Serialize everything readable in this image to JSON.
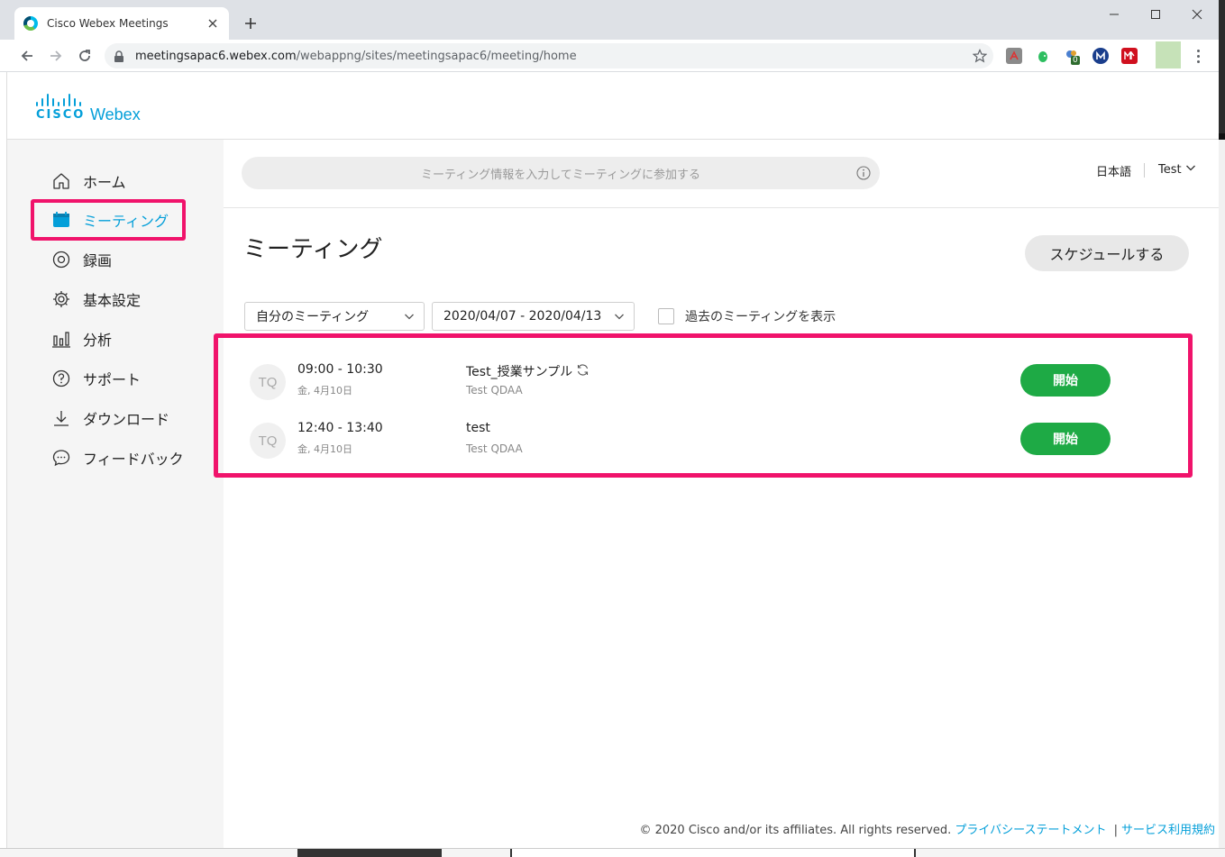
{
  "browser": {
    "tab_title": "Cisco Webex Meetings",
    "url_host": "meetingsapac6.webex.com",
    "url_path": "/webappng/sites/meetingsapac6/meeting/home",
    "extension_badge": "0"
  },
  "header": {
    "logo_cisco": "CISCO",
    "logo_webex": "Webex"
  },
  "search": {
    "placeholder": "ミーティング情報を入力してミーティングに参加する"
  },
  "topbar": {
    "language": "日本語",
    "user": "Test"
  },
  "sidebar": {
    "items": [
      {
        "label": "ホーム",
        "icon": "home-icon"
      },
      {
        "label": "ミーティング",
        "icon": "calendar-icon",
        "active": true
      },
      {
        "label": "録画",
        "icon": "recording-icon"
      },
      {
        "label": "基本設定",
        "icon": "gear-icon"
      },
      {
        "label": "分析",
        "icon": "analytics-icon"
      },
      {
        "label": "サポート",
        "icon": "help-icon"
      },
      {
        "label": "ダウンロード",
        "icon": "download-icon"
      },
      {
        "label": "フィードバック",
        "icon": "feedback-icon"
      }
    ]
  },
  "main": {
    "title": "ミーティング",
    "schedule_label": "スケジュールする",
    "filter_owner": "自分のミーティング",
    "filter_range": "2020/04/07 - 2020/04/13",
    "show_past_label": "過去のミーティングを表示",
    "show_past_checked": false
  },
  "meetings": [
    {
      "avatar": "TQ",
      "time": "09:00 - 10:30",
      "date": "金, 4月10日",
      "title": "Test_授業サンプル",
      "recurring": true,
      "host": "Test QDAA",
      "start_label": "開始"
    },
    {
      "avatar": "TQ",
      "time": "12:40 - 13:40",
      "date": "金, 4月10日",
      "title": "test",
      "recurring": false,
      "host": "Test QDAA",
      "start_label": "開始"
    }
  ],
  "footer": {
    "copyright": "© 2020 Cisco and/or its affiliates. All rights reserved.",
    "privacy_link": "プライバシーステートメント",
    "sep": "|",
    "terms_link": "サービス利用規約"
  },
  "colors": {
    "accent": "#049fd9",
    "start_button": "#1eaa45",
    "highlight": "#f0136b"
  }
}
